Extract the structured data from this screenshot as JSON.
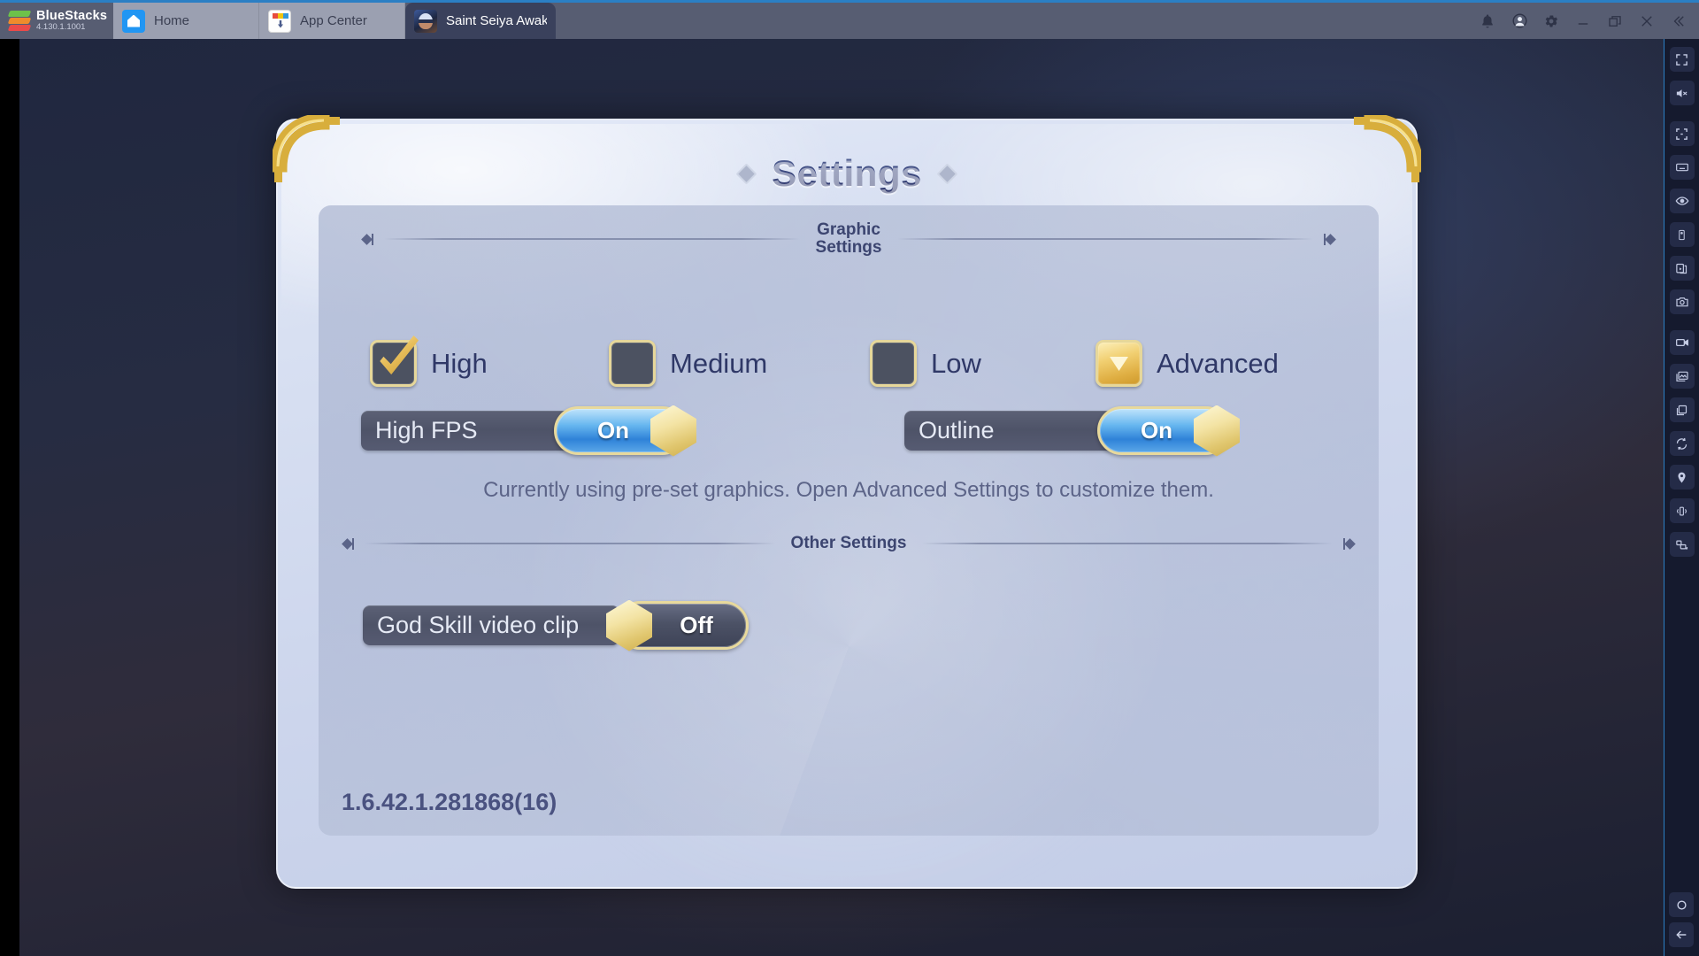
{
  "titlebar": {
    "brand_name": "BlueStacks",
    "brand_version": "4.130.1.1001",
    "tabs": [
      {
        "label": "Home",
        "icon": "home-icon",
        "active": false
      },
      {
        "label": "App Center",
        "icon": "app-center-icon",
        "active": false
      },
      {
        "label": "Saint Seiya Awakeni",
        "icon": "game-icon",
        "active": true
      }
    ],
    "window_controls": [
      {
        "name": "notifications-button",
        "icon": "bell-icon"
      },
      {
        "name": "account-button",
        "icon": "user-avatar-icon"
      },
      {
        "name": "settings-button",
        "icon": "gear-icon"
      },
      {
        "name": "minimize-button",
        "icon": "minimize-icon"
      },
      {
        "name": "maximize-button",
        "icon": "restore-icon"
      },
      {
        "name": "close-button",
        "icon": "close-icon"
      },
      {
        "name": "collapse-sidebar-button",
        "icon": "double-chevron-left-icon"
      }
    ]
  },
  "dialog": {
    "title": "Settings",
    "version": "1.6.42.1.281868(16)",
    "graphic_section": {
      "label": "Graphic\nSettings",
      "options": [
        {
          "label": "High",
          "state": "checked",
          "icon": "checkmark-icon"
        },
        {
          "label": "Medium",
          "state": "unchecked",
          "icon": "empty-checkbox-icon"
        },
        {
          "label": "Low",
          "state": "unchecked",
          "icon": "empty-checkbox-icon"
        },
        {
          "label": "Advanced",
          "state": "button",
          "icon": "chevron-down-icon"
        }
      ],
      "toggles": [
        {
          "label": "High FPS",
          "value": "On"
        },
        {
          "label": "Outline",
          "value": "On"
        }
      ],
      "hint": "Currently using pre-set graphics. Open Advanced Settings to customize them."
    },
    "other_section": {
      "label": "Other Settings",
      "toggles": [
        {
          "label": "God Skill video clip",
          "value": "Off"
        }
      ]
    }
  },
  "sidebar": {
    "items": [
      {
        "name": "fullscreen-icon"
      },
      {
        "name": "mute-icon"
      },
      {
        "name": "fit-to-screen-icon"
      },
      {
        "name": "keyboard-icon"
      },
      {
        "name": "eye-icon"
      },
      {
        "name": "rotate-device-icon"
      },
      {
        "name": "multi-instance-icon"
      },
      {
        "name": "screenshot-camera-icon"
      },
      {
        "name": "video-record-icon"
      },
      {
        "name": "media-manager-icon"
      },
      {
        "name": "clone-instance-icon"
      },
      {
        "name": "sync-icon"
      },
      {
        "name": "location-pin-icon"
      },
      {
        "name": "shake-icon"
      },
      {
        "name": "macro-icon"
      }
    ],
    "nav": [
      {
        "name": "home-circle-button",
        "icon": "circle-icon"
      },
      {
        "name": "back-button",
        "icon": "arrow-left-icon"
      }
    ]
  },
  "colors": {
    "titlebar_bg": "#575d72",
    "accent_blue": "#2b7fc4",
    "gold": "#e8d99c",
    "toggle_on_blue": "#2f82d8",
    "dialog_bg": "#d8e0f2",
    "title_text": "#3d4a80"
  }
}
